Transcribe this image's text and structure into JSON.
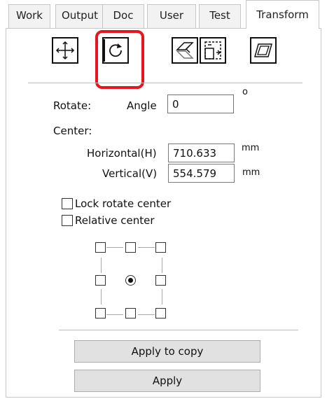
{
  "tabs": [
    {
      "label": "Work"
    },
    {
      "label": "Output"
    },
    {
      "label": "Doc"
    },
    {
      "label": "User"
    },
    {
      "label": "Test"
    },
    {
      "label": "Transform",
      "active": true
    }
  ],
  "toolbar": {
    "tools": [
      {
        "name": "move-icon"
      },
      {
        "name": "rotate-icon",
        "selected": true
      },
      {
        "name": "mirror-icon"
      },
      {
        "name": "scale-icon"
      },
      {
        "name": "skew-icon"
      }
    ],
    "highlight_color": "#e8141e"
  },
  "rotate": {
    "label": "Rotate:",
    "angle_label": "Angle",
    "angle_value": "0",
    "angle_unit": "o"
  },
  "center": {
    "label": "Center:",
    "horizontal_label": "Horizontal(H)",
    "horizontal_value": "710.633",
    "horizontal_unit": "mm",
    "vertical_label": "Vertical(V)",
    "vertical_value": "554.579",
    "vertical_unit": "mm"
  },
  "options": {
    "lock_label": "Lock rotate center",
    "lock_checked": false,
    "relative_label": "Relative center",
    "relative_checked": false
  },
  "anchor_grid": {
    "selected": "center"
  },
  "buttons": {
    "apply_copy": "Apply to copy",
    "apply": "Apply"
  }
}
